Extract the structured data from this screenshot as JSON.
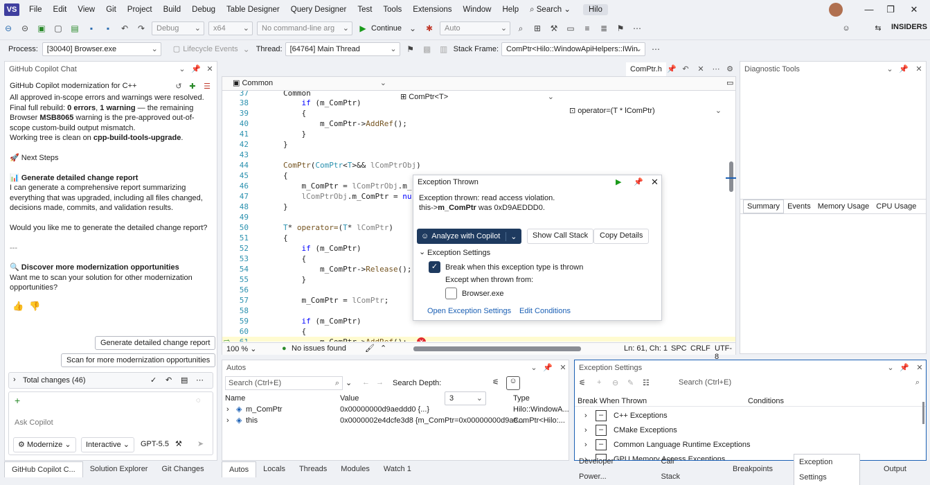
{
  "menubar": {
    "items": [
      "File",
      "Edit",
      "View",
      "Git",
      "Project",
      "Build",
      "Debug",
      "Table Designer",
      "Query Designer",
      "Test",
      "Tools",
      "Extensions",
      "Window",
      "Help"
    ],
    "search": "Search",
    "solution": "Hilo"
  },
  "toolbar1": {
    "config": "Debug",
    "platform": "x64",
    "cmdline": "No command-line arg",
    "continue": "Continue",
    "auto": "Auto",
    "insiders": "INSIDERS"
  },
  "toolbar2": {
    "process_label": "Process:",
    "process": "[30040] Browser.exe",
    "lifecycle": "Lifecycle Events",
    "thread_label": "Thread:",
    "thread": "[64764] Main Thread",
    "stackframe_label": "Stack Frame:",
    "stackframe": "ComPtr<Hilo::WindowApiHelpers::IWin"
  },
  "chat": {
    "title": "GitHub Copilot Chat",
    "heading": "GitHub Copilot modernization for C++",
    "p1": "All approved in-scope errors and warnings were resolved.",
    "p2a": "Final full rebuild: ",
    "p2b": "0 errors",
    "p2c": ", ",
    "p2d": "1 warning",
    "p2e": " — the remaining",
    "p3a": "Browser ",
    "p3b": "MSB8065",
    "p3c": " warning is the pre-approved out-of-",
    "p4": "scope custom-build output mismatch.",
    "p5a": "Working tree is clean on ",
    "p5b": "cpp-build-tools-upgrade",
    "next_steps": "🚀 Next Steps",
    "gen_title": "📊 Generate detailed change report",
    "gen_p1": "I can generate a comprehensive report summarizing",
    "gen_p2": "everything that was upgraded, including all files changed,",
    "gen_p3": "decisions made, commits, and validation results.",
    "question": "Would you like me to generate the detailed change report?",
    "rule": "---",
    "disc_title": "🔍 Discover more modernization opportunities",
    "disc_p1": "Want me to scan your solution for other modernization",
    "disc_p2": "opportunities?",
    "btn_report": "Generate detailed change report",
    "btn_scan": "Scan for more modernization opportunities",
    "total_changes": "Total changes (46)",
    "ask": "Ask Copilot",
    "mode": "Modernize",
    "interaction": "Interactive",
    "model": "GPT-5.5"
  },
  "left_tabs": [
    "GitHub Copilot C...",
    "Solution Explorer",
    "Git Changes"
  ],
  "editor": {
    "tab": "ComPtr.h",
    "scope": "Common",
    "class": "ComPtr<T>",
    "member": "operator=(T * lComPtr)",
    "zoom": "100 %",
    "issues": "No issues found",
    "pos": "Ln: 61, Ch: 1",
    "spc": "SPC",
    "crlf": "CRLF",
    "enc": "UTF-8",
    "lines": [
      [
        "37",
        "Common"
      ],
      [
        "38",
        "        if (m_ComPtr)"
      ],
      [
        "39",
        "        {"
      ],
      [
        "40",
        "            m_ComPtr->AddRef();"
      ],
      [
        "41",
        "        }"
      ],
      [
        "42",
        "    }"
      ],
      [
        "43",
        ""
      ],
      [
        "44",
        "    ComPtr(ComPtr<T>&& lComPtrObj)"
      ],
      [
        "45",
        "    {"
      ],
      [
        "46",
        "        m_ComPtr = lComPtrObj.m_"
      ],
      [
        "47",
        "        lComPtrObj.m_ComPtr = nu"
      ],
      [
        "48",
        "    }"
      ],
      [
        "49",
        ""
      ],
      [
        "50",
        "    T* operator=(T* lComPtr)"
      ],
      [
        "51",
        "    {"
      ],
      [
        "52",
        "        if (m_ComPtr)"
      ],
      [
        "53",
        "        {"
      ],
      [
        "54",
        "            m_ComPtr->Release();"
      ],
      [
        "55",
        "        }"
      ],
      [
        "56",
        ""
      ],
      [
        "57",
        "        m_ComPtr = lComPtr;"
      ],
      [
        "58",
        ""
      ],
      [
        "59",
        "        if (m_ComPtr)"
      ],
      [
        "60",
        "        {"
      ],
      [
        "61",
        "            m_ComPtr->AddRef();"
      ]
    ]
  },
  "exception": {
    "title": "Exception Thrown",
    "msg1": "Exception thrown: read access violation.",
    "msg2a": "this->",
    "msg2b": "m_ComPtr",
    "msg2c": " was 0xD9AEDDD0.",
    "analyze": "Analyze with Copilot",
    "callstack": "Show Call Stack",
    "copy": "Copy Details",
    "settings": "Exception Settings",
    "break": "Break when this exception type is thrown",
    "except": "Except when thrown from:",
    "module": "Browser.exe",
    "open": "Open Exception Settings",
    "edit": "Edit Conditions"
  },
  "diag": {
    "title": "Diagnostic Tools",
    "tabs": [
      "Summary",
      "Events",
      "Memory Usage",
      "CPU Usage"
    ]
  },
  "autos": {
    "title": "Autos",
    "search": "Search (Ctrl+E)",
    "depth_label": "Search Depth:",
    "depth": "3",
    "cols": [
      "Name",
      "Value",
      "Type"
    ],
    "rows": [
      [
        "m_ComPtr",
        "0x00000000d9aeddd0 {...}",
        "Hilo::WindowA..."
      ],
      [
        "this",
        "0x0000002e4dcfe3d8 {m_ComPtr=0x00000000d9ae...",
        "ComPtr<Hilo:..."
      ]
    ],
    "tabs": [
      "Autos",
      "Locals",
      "Threads",
      "Modules",
      "Watch 1"
    ]
  },
  "excset": {
    "title": "Exception Settings",
    "search": "Search (Ctrl+E)",
    "cols": [
      "Break When Thrown",
      "Conditions"
    ],
    "rows": [
      "C++ Exceptions",
      "CMake Exceptions",
      "Common Language Runtime Exceptions",
      "GPU Memory Access Exceptions"
    ],
    "tabs": [
      "Developer Power...",
      "Call Stack",
      "Breakpoints",
      "Exception Settings",
      "Output"
    ]
  }
}
